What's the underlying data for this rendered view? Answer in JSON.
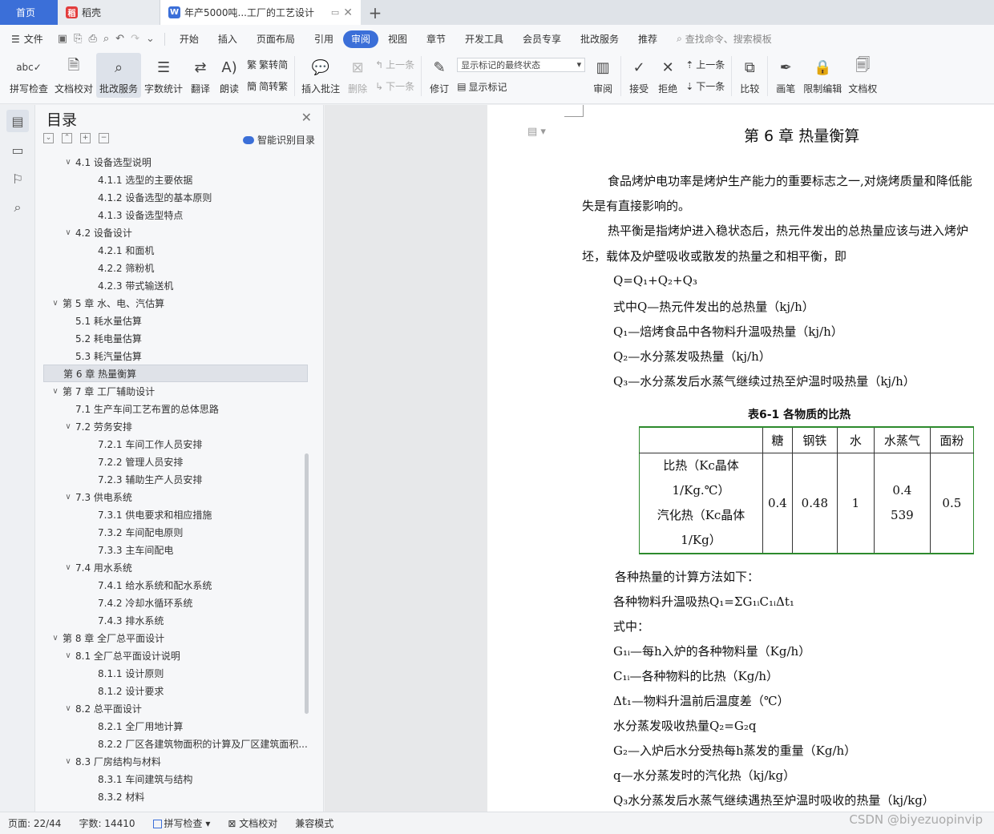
{
  "tabs": {
    "home": "首页",
    "doke": "稻壳",
    "doc": "年产5000吨...工厂的工艺设计"
  },
  "menu": {
    "file": "文件",
    "items": [
      "开始",
      "插入",
      "页面布局",
      "引用",
      "审阅",
      "视图",
      "章节",
      "开发工具",
      "会员专享",
      "批改服务",
      "推荐"
    ],
    "active": "审阅",
    "search": "查找命令、搜索模板"
  },
  "ribbon": {
    "spell": "拼写检查",
    "proof": "文档校对",
    "review_service": "批改服务",
    "word_count": "字数统计",
    "translate": "翻译",
    "read": "朗读",
    "to_trad": "繁转简",
    "to_simp": "简转繁",
    "insert_comment": "插入批注",
    "delete": "删除",
    "prev1": "上一条",
    "next1": "下一条",
    "track": "修订",
    "markup_state": "显示标记的最终状态",
    "show_markup": "显示标记",
    "review": "审阅",
    "accept": "接受",
    "reject": "拒绝",
    "prev2": "上一条",
    "next2": "下一条",
    "compare": "比较",
    "pen": "画笔",
    "restrict": "限制编辑",
    "doc_perm": "文档权"
  },
  "toc": {
    "title": "目录",
    "smart": "智能识别目录",
    "items": [
      {
        "lv": 2,
        "arrow": true,
        "text": "4.1  设备选型说明"
      },
      {
        "lv": 3,
        "arrow": false,
        "text": "4.1.1  选型的主要依据"
      },
      {
        "lv": 3,
        "arrow": false,
        "text": "4.1.2 设备选型的基本原则"
      },
      {
        "lv": 3,
        "arrow": false,
        "text": "4.1.3  设备选型特点"
      },
      {
        "lv": 2,
        "arrow": true,
        "text": "4.2    设备设计"
      },
      {
        "lv": 3,
        "arrow": false,
        "text": "4.2.1  和面机"
      },
      {
        "lv": 3,
        "arrow": false,
        "text": "4.2.2  筛粉机"
      },
      {
        "lv": 3,
        "arrow": false,
        "text": "4.2.3  带式输送机"
      },
      {
        "lv": 1,
        "arrow": true,
        "text": "第 5 章  水、电、汽估算"
      },
      {
        "lv": 2,
        "arrow": false,
        "text": "5.1  耗水量估算"
      },
      {
        "lv": 2,
        "arrow": false,
        "text": "5.2  耗电量估算"
      },
      {
        "lv": 2,
        "arrow": false,
        "text": "5.3  耗汽量估算"
      },
      {
        "lv": 1,
        "arrow": false,
        "text": "第 6 章  热量衡算",
        "active": true
      },
      {
        "lv": 1,
        "arrow": true,
        "text": "第 7 章  工厂辅助设计"
      },
      {
        "lv": 2,
        "arrow": false,
        "text": "7.1  生产车间工艺布置的总体思路"
      },
      {
        "lv": 2,
        "arrow": true,
        "text": "7.2  劳务安排"
      },
      {
        "lv": 3,
        "arrow": false,
        "text": "7.2.1  车间工作人员安排"
      },
      {
        "lv": 3,
        "arrow": false,
        "text": "7.2.2  管理人员安排"
      },
      {
        "lv": 3,
        "arrow": false,
        "text": "7.2.3  辅助生产人员安排"
      },
      {
        "lv": 2,
        "arrow": true,
        "text": "7.3  供电系统"
      },
      {
        "lv": 3,
        "arrow": false,
        "text": "7.3.1  供电要求和相应措施"
      },
      {
        "lv": 3,
        "arrow": false,
        "text": "7.3.2  车间配电原则"
      },
      {
        "lv": 3,
        "arrow": false,
        "text": "7.3.3  主车间配电"
      },
      {
        "lv": 2,
        "arrow": true,
        "text": "7.4  用水系统"
      },
      {
        "lv": 3,
        "arrow": false,
        "text": "7.4.1  给水系统和配水系统"
      },
      {
        "lv": 3,
        "arrow": false,
        "text": "7.4.2  冷却水循环系统"
      },
      {
        "lv": 3,
        "arrow": false,
        "text": "7.4.3  排水系统"
      },
      {
        "lv": 1,
        "arrow": true,
        "text": "第 8 章  全厂总平面设计"
      },
      {
        "lv": 2,
        "arrow": true,
        "text": "8.1  全厂总平面设计说明"
      },
      {
        "lv": 3,
        "arrow": false,
        "text": "8.1.1  设计原则"
      },
      {
        "lv": 3,
        "arrow": false,
        "text": "8.1.2  设计要求"
      },
      {
        "lv": 2,
        "arrow": true,
        "text": "8.2  总平面设计"
      },
      {
        "lv": 3,
        "arrow": false,
        "text": "8.2.1  全厂用地计算"
      },
      {
        "lv": 3,
        "arrow": false,
        "text": "8.2.2  厂区各建筑物面积的计算及厂区建筑面积..."
      },
      {
        "lv": 2,
        "arrow": true,
        "text": "8.3  厂房结构与材料"
      },
      {
        "lv": 3,
        "arrow": false,
        "text": "8.3.1  车间建筑与结构"
      },
      {
        "lv": 3,
        "arrow": false,
        "text": "8.3.2  材料"
      }
    ]
  },
  "doc": {
    "heading": "第 6 章  热量衡算",
    "p1a": "食品烤炉电功率是烤炉生产能力的重要标志之一,对烧烤质量和降低能",
    "p1b": "失是有直接影响的。",
    "p2a": "热平衡是指烤炉进入稳状态后，热元件发出的总热量应该与进入烤炉",
    "p2b": "坯，载体及炉壁吸收或散发的热量之和相平衡，即",
    "eq1": "Q=Q₁+Q₂+Q₃",
    "eq2": "式中Q—热元件发出的总热量（kj/h）",
    "eq3": "Q₁—焙烤食品中各物料升温吸热量（kj/h）",
    "eq4": "Q₂—水分蒸发吸热量（kj/h）",
    "eq5": "Q₃—水分蒸发后水蒸气继续过热至炉温时吸热量（kj/h）",
    "table_caption": "表6-1  各物质的比热",
    "table_head": [
      "",
      "糖",
      "钢铁",
      "水",
      "水蒸气",
      "面粉"
    ],
    "row_label_1a": "比热（Kc晶体",
    "row_label_1b": "1/Kg.℃）",
    "row_label_2a": "汽化热（Kc晶体",
    "row_label_2b": "1/Kg）",
    "v_sugar": "0.4",
    "v_steel": "0.48",
    "v_water": "1",
    "v_vapor_1": "0.4",
    "v_vapor_2": "539",
    "v_flour": "0.5",
    "l1": "各种热量的计算方法如下：",
    "l2": "各种物料升温吸热Q₁=ΣG₁ᵢC₁ᵢΔt₁",
    "l3": "式中：",
    "l4": "G₁ᵢ—每h入炉的各种物料量（Kg/h）",
    "l5": "C₁ᵢ—各种物料的比热（Kg/h）",
    "l6": "Δt₁—物料升温前后温度差（℃）",
    "l7": "水分蒸发吸收热量Q₂=G₂q",
    "l8": "G₂—入炉后水分受热每h蒸发的重量（Kg/h）",
    "l9": "q—水分蒸发时的汽化热（kj/kg）",
    "l10": "Q₃水分蒸发后水蒸气继续遇热至炉温时吸收的热量（kj/kg）"
  },
  "status": {
    "page": "页面: 22/44",
    "words": "字数: 14410",
    "spell": "拼写检查",
    "proof": "文档校对",
    "compat": "兼容模式"
  },
  "watermark": "CSDN @biyezuopinvip",
  "colors": {
    "accent": "#3b6fd8",
    "table_border": "#2d8a2d"
  }
}
